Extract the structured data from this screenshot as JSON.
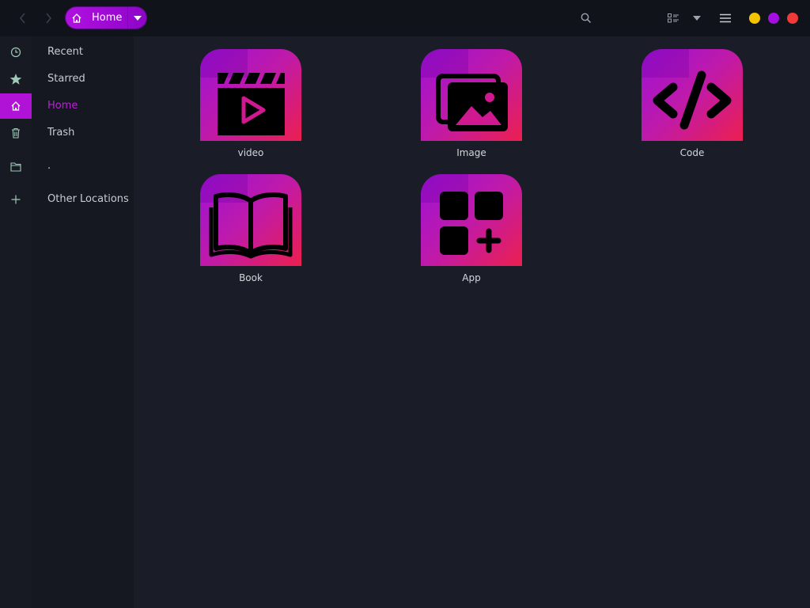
{
  "header": {
    "back_icon": "chevron-left-icon",
    "forward_icon": "chevron-right-icon",
    "path": {
      "label": "Home",
      "icon": "home-icon",
      "dropdown_icon": "caret-down-icon"
    },
    "search_icon": "search-icon",
    "view_icon": "list-view-icon",
    "view_menu_icon": "caret-down-icon",
    "menu_icon": "hamburger-icon",
    "window_controls": {
      "minimize_color": "#f5c400",
      "maximize_color": "#a20fe0",
      "close_color": "#f03a3a"
    }
  },
  "sidebar": {
    "items": [
      {
        "label": "Recent",
        "icon": "clock-icon"
      },
      {
        "label": "Starred",
        "icon": "star-icon"
      },
      {
        "label": "Home",
        "icon": "home-icon",
        "active": true
      },
      {
        "label": "Trash",
        "icon": "trash-icon"
      },
      {
        "label": ".",
        "icon": "folder-icon"
      },
      {
        "label": "Other Locations",
        "icon": "plus-icon"
      }
    ]
  },
  "files": [
    {
      "name": "video",
      "icon": "clapperboard-icon"
    },
    {
      "name": "Image",
      "icon": "image-icon"
    },
    {
      "name": "Code",
      "icon": "code-icon"
    },
    {
      "name": "Book",
      "icon": "book-icon"
    },
    {
      "name": "App",
      "icon": "apps-icon"
    }
  ],
  "colors": {
    "accent": "#b012d6",
    "background": "#1a1d27",
    "headerbar": "#11131a"
  }
}
